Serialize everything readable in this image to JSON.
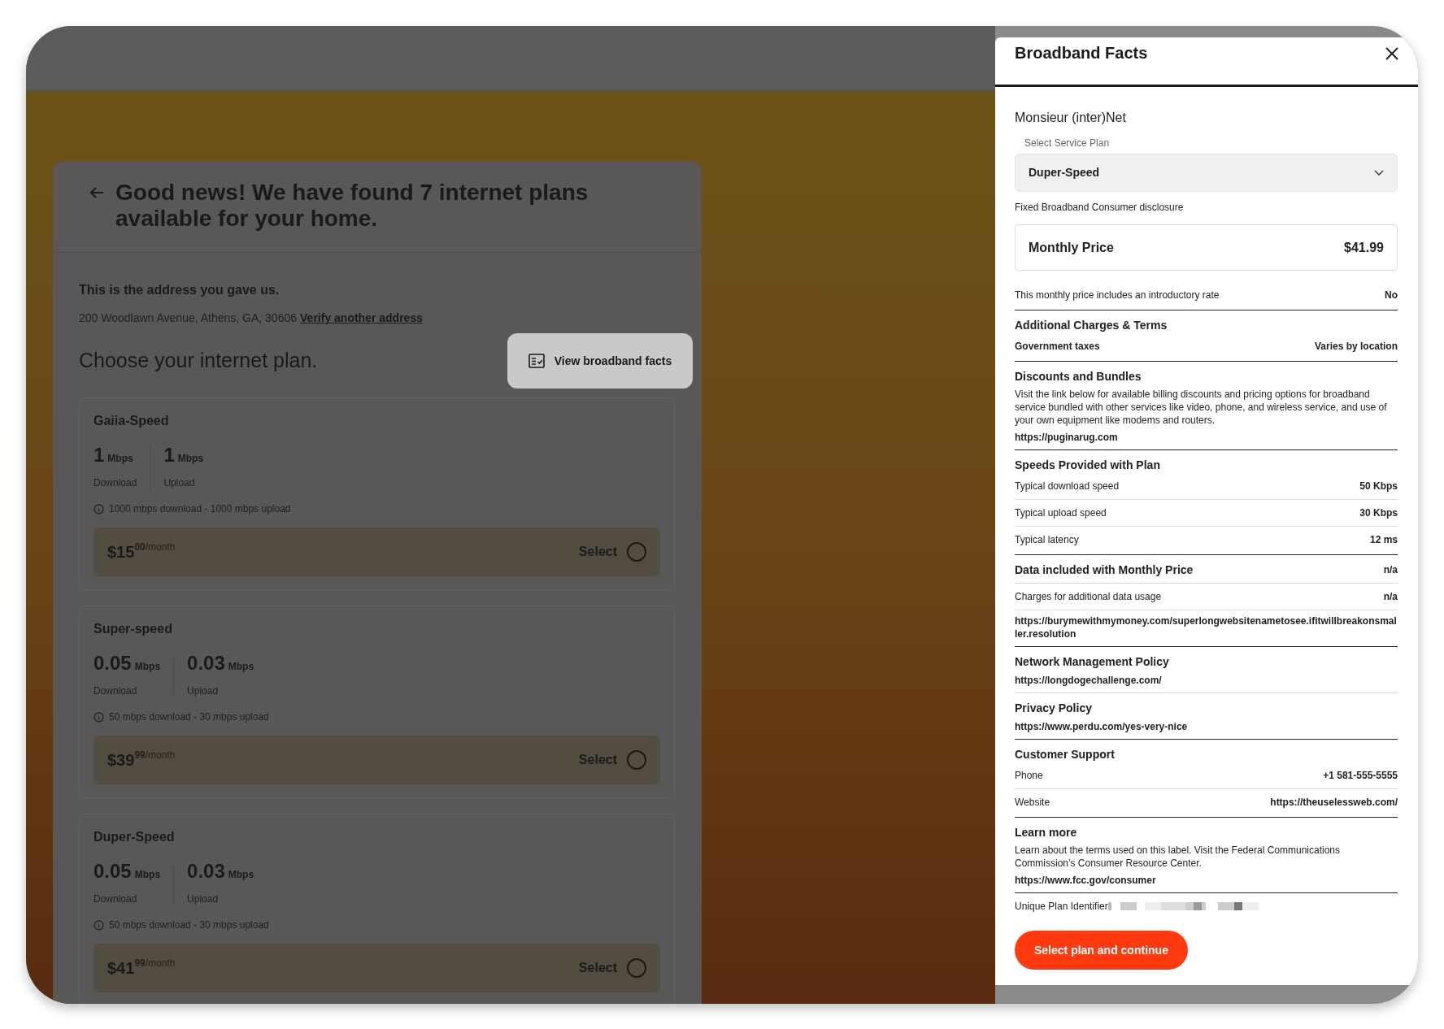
{
  "plans_page": {
    "heading": "Good news! We have found 7 internet plans available for your home.",
    "address_title": "This is the address you gave us.",
    "address": "200 Woodlawn Avenue, Athens, GA, 30606",
    "verify_link": "Verify another address",
    "choose_title": "Choose your internet plan.",
    "facts_button": "View broadband facts",
    "plans": [
      {
        "name": "Gaiia-Speed",
        "download": {
          "value": "1",
          "unit": "Mbps",
          "label": "Download"
        },
        "upload": {
          "value": "1",
          "unit": "Mbps",
          "label": "Upload"
        },
        "note": "1000 mbps download - 1000 mbps upload",
        "price": {
          "dollars": "$15",
          "cents": "00",
          "period": "/month"
        },
        "select_label": "Select",
        "selected": false
      },
      {
        "name": "Super-speed",
        "download": {
          "value": "0.05",
          "unit": "Mbps",
          "label": "Download"
        },
        "upload": {
          "value": "0.03",
          "unit": "Mbps",
          "label": "Upload"
        },
        "note": "50 mbps download - 30 mbps upload",
        "price": {
          "dollars": "$39",
          "cents": "99",
          "period": "/month"
        },
        "select_label": "Select",
        "selected": false
      },
      {
        "name": "Duper-Speed",
        "download": {
          "value": "0.05",
          "unit": "Mbps",
          "label": "Download"
        },
        "upload": {
          "value": "0.03",
          "unit": "Mbps",
          "label": "Upload"
        },
        "note": "50 mbps download - 30 mbps upload",
        "price": {
          "dollars": "$41",
          "cents": "99",
          "period": "/month"
        },
        "select_label": "Select",
        "selected": false
      }
    ]
  },
  "facts_panel": {
    "title": "Broadband Facts",
    "provider": "Monsieur (inter)Net",
    "select_label": "Select Service Plan",
    "select_value": "Duper-Speed",
    "disclosure": "Fixed Broadband Consumer disclosure",
    "monthly_price": {
      "label": "Monthly Price",
      "value": "$41.99"
    },
    "sections": [
      {
        "strong_divider": true,
        "rows": [
          {
            "label": "This monthly price includes an introductory rate",
            "value": "No",
            "emphasis": false
          }
        ]
      },
      {
        "strong_divider": true,
        "heading": "Additional Charges & Terms",
        "rows": [
          {
            "label": "Government taxes",
            "value": "Varies by location",
            "emphasis": true
          }
        ]
      },
      {
        "strong_divider": true,
        "heading": "Discounts and Bundles",
        "text": "Visit the link below for available billing discounts and pricing options for broadband service bundled with other services like video, phone, and wireless service, and use of your own equipment like modems and routers.",
        "links": [
          "https://puginarug.com"
        ]
      },
      {
        "strong_divider": true,
        "heading": "Speeds Provided with Plan",
        "rows": [
          {
            "label": "Typical download speed",
            "value": "50 Kbps",
            "emphasis": false
          },
          {
            "label": "Typical upload speed",
            "value": "30 Kbps",
            "emphasis": false
          },
          {
            "label": "Typical latency",
            "value": "12 ms",
            "emphasis": false
          }
        ]
      },
      {
        "strong_divider": true,
        "heading": "Data included with Monthly Price",
        "heading_value": "n/a",
        "rows": [
          {
            "label": "Charges for additional data usage",
            "value": "n/a",
            "emphasis": false
          }
        ],
        "links": [
          "https://burymewithmymoney.com/superlongwebsitenametosee.ifitwillbreakonsmaller.resolution"
        ]
      },
      {
        "strong_divider": false,
        "heading": "Network Management Policy",
        "links": [
          "https://longdogechallenge.com/"
        ]
      },
      {
        "strong_divider": true,
        "heading": "Privacy Policy",
        "links": [
          "https://www.perdu.com/yes-very-nice"
        ]
      },
      {
        "strong_divider": true,
        "heading": "Customer Support",
        "rows": [
          {
            "label": "Phone",
            "value": "+1 581-555-5555",
            "emphasis": false
          },
          {
            "label": "Website",
            "value": "https://theuselessweb.com/",
            "emphasis": false
          }
        ]
      },
      {
        "strong_divider": true,
        "heading": "Learn more",
        "text": "Learn about the terms used on this label. Visit the Federal Communications Commission’s Consumer Resource Center.",
        "links": [
          "https://www.fcc.gov/consumer"
        ]
      }
    ],
    "plan_identifier_label": "Unique Plan Identifier",
    "continue_button": "Select plan and continue"
  }
}
